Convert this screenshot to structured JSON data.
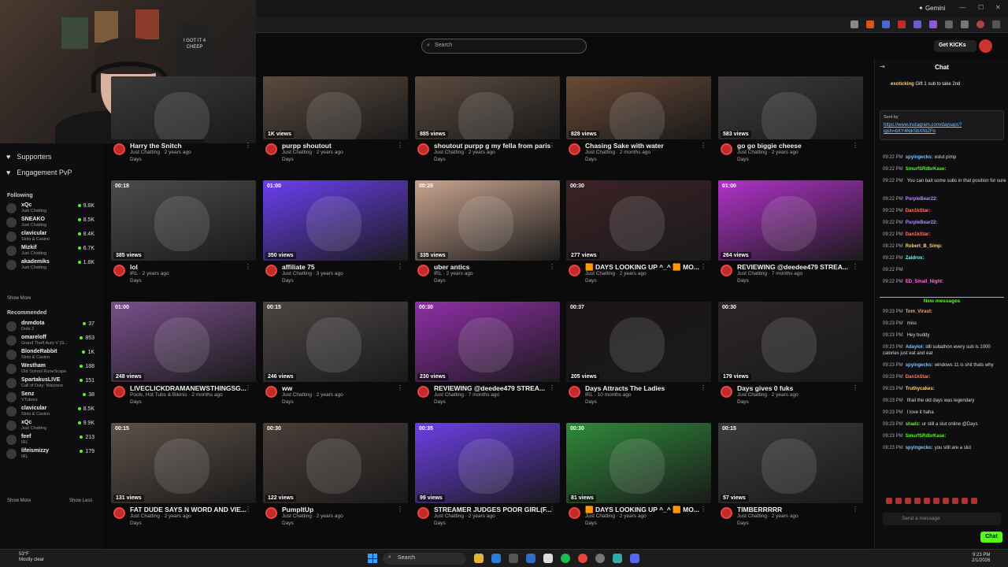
{
  "browser": {
    "gemini_label": "Gemini",
    "search_placeholder": "Search",
    "get_kicks_label": "Get KICKs"
  },
  "webcam": {
    "shirt_text": "I GOT IT 4 CHEEP"
  },
  "sidebar": {
    "top_items": [
      {
        "label": "Supporters",
        "icon": "heart-icon"
      },
      {
        "label": "Engagement PvP",
        "icon": "heart-icon"
      }
    ],
    "following_label": "Following",
    "following": [
      {
        "name": "xQc",
        "category": "Just Chatting",
        "viewers": "9.8K"
      },
      {
        "name": "SNEAKO",
        "category": "Just Chatting",
        "viewers": "8.5K"
      },
      {
        "name": "clavicular",
        "category": "Slots & Casino",
        "viewers": "8.4K"
      },
      {
        "name": "Mizkif",
        "category": "Just Chatting",
        "viewers": "6.7K"
      },
      {
        "name": "akademiks",
        "category": "Just Chatting",
        "viewers": "1.8K"
      }
    ],
    "show_more_1": "Show More",
    "recommended_label": "Recommended",
    "recommended": [
      {
        "name": "dnmdota",
        "category": "Dota 2",
        "viewers": "37"
      },
      {
        "name": "omareloff",
        "category": "Grand Theft Auto V (G...",
        "viewers": "853"
      },
      {
        "name": "BlondeRabbit",
        "category": "Slots & Casino",
        "viewers": "1K"
      },
      {
        "name": "Westham",
        "category": "Old School RuneScape",
        "viewers": "188"
      },
      {
        "name": "SpartakusLIVE",
        "category": "Call of Duty: Warzone",
        "viewers": "151"
      },
      {
        "name": "Senz",
        "category": "VTubers",
        "viewers": "38"
      },
      {
        "name": "clavicular",
        "category": "Slots & Casino",
        "viewers": "8.5K"
      },
      {
        "name": "xQc",
        "category": "Just Chatting",
        "viewers": "9.9K"
      },
      {
        "name": "feef",
        "category": "IRL",
        "viewers": "213"
      },
      {
        "name": "lifeismizzy",
        "category": "IRL",
        "viewers": "179"
      }
    ],
    "show_more_2": "Show More",
    "show_less": "Show Less"
  },
  "clips": [
    {
      "title": "Harry the Snitch",
      "meta": "Just Chatting · 2 years ago",
      "channel": "Days",
      "duration": "",
      "views": "",
      "color": "#3a3a3a"
    },
    {
      "title": "purpp shoutout",
      "meta": "Just Chatting · 2 years ago",
      "channel": "Days",
      "duration": "",
      "views": "1K views",
      "color": "#5b4a3e"
    },
    {
      "title": "shoutout purpp g my fella from paris",
      "meta": "Just Chatting · 2 years ago",
      "channel": "Days",
      "duration": "",
      "views": "885 views",
      "color": "#5b4a3e"
    },
    {
      "title": "Chasing Sake with water",
      "meta": "Just Chatting · 2 months ago",
      "channel": "Days",
      "duration": "",
      "views": "828 views",
      "color": "#6a4a36"
    },
    {
      "title": "go go biggie cheese",
      "meta": "Just Chatting · 2 years ago",
      "channel": "Days",
      "duration": "",
      "views": "583 views",
      "color": "#3e3a3c"
    },
    {
      "title": "lol",
      "meta": "IRL · 2 years ago",
      "channel": "Days",
      "duration": "00:18",
      "views": "385 views",
      "color": "#4d4b4e"
    },
    {
      "title": "affiliate 75",
      "meta": "Just Chatting · 3 years ago",
      "channel": "Days",
      "duration": "01:00",
      "views": "350 views",
      "color": "#6b3ff0"
    },
    {
      "title": "uber antics",
      "meta": "IRL · 2 years ago",
      "channel": "Days",
      "duration": "00:20",
      "views": "335 views",
      "color": "#c9a48f"
    },
    {
      "title": "🟧 DAYS LOOKING UP ^_^ 🟧 MO...",
      "meta": "Just Chatting · 2 years ago",
      "channel": "Days",
      "duration": "00:30",
      "views": "277 views",
      "color": "#3c2226"
    },
    {
      "title": "REVIEWING @deedee479 STREA...",
      "meta": "Just Chatting · 7 months ago",
      "channel": "Days",
      "duration": "01:00",
      "views": "264 views",
      "color": "#b032c9"
    },
    {
      "title": "LIVECLICKDRAMANEWSTHINGSG...",
      "meta": "Pools, Hot Tubs & Bikinis · 2 months ago",
      "channel": "Days",
      "duration": "01:00",
      "views": "248 views",
      "color": "#7a4f8c"
    },
    {
      "title": "ww",
      "meta": "Just Chatting · 2 years ago",
      "channel": "Days",
      "duration": "00:15",
      "views": "246 views",
      "color": "#4b4644"
    },
    {
      "title": "REVIEWING @deedee479 STREA...",
      "meta": "Just Chatting · 7 months ago",
      "channel": "Days",
      "duration": "00:30",
      "views": "230 views",
      "color": "#8f2fa8"
    },
    {
      "title": "Days Attracts The Ladies",
      "meta": "IRL · 10 months ago",
      "channel": "Days",
      "duration": "00:37",
      "views": "205 views",
      "color": "#1a1418"
    },
    {
      "title": "Days gives 0 fuks",
      "meta": "Just Chatting · 2 years ago",
      "channel": "Days",
      "duration": "00:30",
      "views": "179 views",
      "color": "#2c2526"
    },
    {
      "title": "FAT DUDE SAYS N WORD AND VIE...",
      "meta": "Just Chatting · 2 years ago",
      "channel": "Days",
      "duration": "00:15",
      "views": "131 views",
      "color": "#5e5148"
    },
    {
      "title": "PumpItUp",
      "meta": "Just Chatting · 2 years ago",
      "channel": "Days",
      "duration": "00:30",
      "views": "122 views",
      "color": "#4a3e39"
    },
    {
      "title": "STREAMER JUDGES POOR GIRL(F...",
      "meta": "Just Chatting · 2 years ago",
      "channel": "Days",
      "duration": "00:35",
      "views": "99 views",
      "color": "#6d3fe6"
    },
    {
      "title": "🟧 DAYS LOOKING UP ^_^ 🟧 MO...",
      "meta": "Just Chatting · 2 years ago",
      "channel": "Days",
      "duration": "00:30",
      "views": "81 views",
      "color": "#2f8a3a"
    },
    {
      "title": "TIMBERRRRR",
      "meta": "Just Chatting · 2 years ago",
      "channel": "Days",
      "duration": "00:15",
      "views": "57 views",
      "color": "#3d3a3b"
    }
  ],
  "chat": {
    "header": "Chat",
    "gift_user": "exoticking",
    "gift_text": "Gift 1 sub to take 2nd",
    "pinned_from": "Sent by",
    "pinned_link": "https://www.instagram.com/daysaps?igsh=bXY4NjkSbXNtZFo",
    "messages_before": [
      {
        "time": "09:22 PM",
        "user": "spyingecko:",
        "text": "eslut pimp",
        "color": "#7cc4ff"
      },
      {
        "time": "09:22 PM",
        "user": "SmurfSRdbrKase:",
        "text": "",
        "color": "#53fc18"
      },
      {
        "time": "09:22 PM",
        "user": "",
        "text": "You can bait some subs in that position for sure",
        "color": "#ff6bd5"
      },
      {
        "time": "09:22 PM",
        "user": "PurpleBear22:",
        "text": "",
        "color": "#b58cff"
      },
      {
        "time": "09:22 PM",
        "user": "Dan1kStar:",
        "text": "",
        "color": "#ff7b6b"
      },
      {
        "time": "09:22 PM",
        "user": "PurpleBear22:",
        "text": "",
        "color": "#b58cff"
      },
      {
        "time": "09:22 PM",
        "user": "Dan1kStar:",
        "text": "",
        "color": "#ff7b6b"
      },
      {
        "time": "09:22 PM",
        "user": "Robert_B_Simp:",
        "text": "",
        "color": "#ffd36b"
      },
      {
        "time": "09:22 PM",
        "user": "Zaidrox:",
        "text": "",
        "color": "#6bfff0"
      },
      {
        "time": "09:22 PM",
        "user": "",
        "text": "",
        "color": "#ff6b6b"
      },
      {
        "time": "09:22 PM",
        "user": "ED_Small_Night:",
        "text": "",
        "color": "#ff6bd5"
      }
    ],
    "new_messages_label": "New messages",
    "messages_after": [
      {
        "time": "09:23 PM",
        "user": "Tom_Virast:",
        "text": "",
        "color": "#ff9f6b"
      },
      {
        "time": "09:23 PM",
        "user": "",
        "text": "miss",
        "color": "#ff6bd5"
      },
      {
        "time": "09:23 PM",
        "user": "",
        "text": "Hey buddy",
        "color": "#ff6bd5"
      },
      {
        "time": "09:23 PM",
        "user": "Adaylol:",
        "text": "ldll subathon every sub is 1000 calories just eat and eat",
        "color": "#7cc4ff"
      },
      {
        "time": "09:23 PM",
        "user": "spyingecko:",
        "text": "windows 11 is shit thats why",
        "color": "#7cc4ff"
      },
      {
        "time": "09:23 PM",
        "user": "Dan1kStar:",
        "text": "",
        "color": "#ff7b6b"
      },
      {
        "time": "09:23 PM",
        "user": "Truthycakes:",
        "text": "",
        "color": "#ffd36b"
      },
      {
        "time": "09:23 PM",
        "user": "",
        "text": "Ifrail the old days was legendary",
        "color": "#ff6bd5"
      },
      {
        "time": "09:23 PM",
        "user": "",
        "text": "I love it haha",
        "color": "#ff6bd5"
      },
      {
        "time": "09:23 PM",
        "user": "shadz:",
        "text": "ur still a slut online @Days",
        "color": "#53fc18"
      },
      {
        "time": "09:23 PM",
        "user": "SmurfSRdbrKase:",
        "text": "",
        "color": "#53fc18"
      },
      {
        "time": "09:23 PM",
        "user": "spyingecko:",
        "text": "you still are a slut",
        "color": "#7cc4ff"
      }
    ],
    "send_placeholder": "Send a message",
    "chat_button": "Chat"
  },
  "taskbar": {
    "temp": "53°F",
    "weather": "Mostly clear",
    "search_label": "Search",
    "time": "9:23 PM",
    "date": "2/1/2026"
  }
}
